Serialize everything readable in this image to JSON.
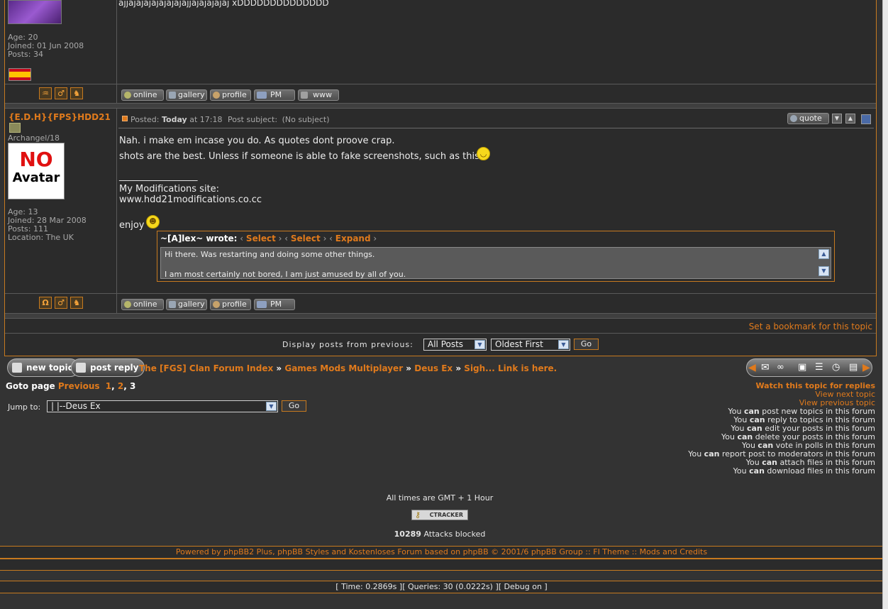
{
  "prev_post": {
    "body_text": "ajjajajajajajajajajjajajajajaj xDDDDDDDDDDDDDD",
    "age": "Age: 20",
    "joined": "Joined: 01 Jun 2008",
    "posts": "Posts: 34",
    "buttons": [
      "online",
      "gallery",
      "profile",
      "PM",
      "www"
    ]
  },
  "post": {
    "author": "{E.D.H}{FPS}HDD21",
    "rank": "Archangel/18",
    "avatar_line1": "NO",
    "avatar_line2": "Avatar",
    "age": "Age: 13",
    "joined": "Joined: 28 Mar 2008",
    "posts": "Posts: 111",
    "location": "Location: The UK",
    "posted_label": "Posted:",
    "posted_day": "Today",
    "posted_time": "at 17:18",
    "subject_label": "Post subject:",
    "subject_value": "(No subject)",
    "quote_button": "quote",
    "line1": "Nah. i make em incase you do. As quotes dont proove crap.",
    "line2": "shots are the best. Unless if someone is able to fake screenshots, such as this.",
    "separator": "_________________",
    "sig_label": "My Modifications site:",
    "sig_link": "www.hdd21modifications.co.cc",
    "enjoy": "enjoy",
    "quote_author": "~[A]lex~ wrote:",
    "quote_select1": "Select",
    "quote_select2": "Select",
    "quote_expand": "Expand",
    "quote_line1": "Hi there. Was restarting and doing some other things.",
    "quote_line2": "I am most certainly not bored, I am just amused by all of you.",
    "buttons": [
      "online",
      "gallery",
      "profile",
      "PM"
    ]
  },
  "bookmark": "Set a bookmark for this topic",
  "display": {
    "label": "Display posts from previous:",
    "posts_select": "All Posts",
    "order_select": "Oldest First",
    "go": "Go"
  },
  "nav": {
    "new_topic": "new topic",
    "post_reply": "post reply",
    "breadcrumb": [
      "The [FGS] Clan Forum Index",
      "Games Mods Multiplayer",
      "Deus Ex",
      "Sigh... Link is here."
    ],
    "sep": "»"
  },
  "pagination": {
    "label": "Goto page",
    "previous": "Previous",
    "p1": "1",
    "p2": "2",
    "p3": "3"
  },
  "jump": {
    "label": "Jump to:",
    "value": "|   |--Deus Ex",
    "go": "Go"
  },
  "right_links": [
    "Watch this topic for replies",
    "View next topic",
    "View previous topic"
  ],
  "permissions": [
    {
      "pre": "You ",
      "can": "can",
      "post": " post new topics in this forum"
    },
    {
      "pre": "You ",
      "can": "can",
      "post": " reply to topics in this forum"
    },
    {
      "pre": "You ",
      "can": "can",
      "post": " edit your posts in this forum"
    },
    {
      "pre": "You ",
      "can": "can",
      "post": " delete your posts in this forum"
    },
    {
      "pre": "You ",
      "can": "can",
      "post": " vote in polls in this forum"
    },
    {
      "pre": "You ",
      "can": "can",
      "post": " report post to moderators in this forum"
    },
    {
      "pre": "You ",
      "can": "can",
      "post": " attach files in this forum"
    },
    {
      "pre": "You ",
      "can": "can",
      "post": " download files in this forum"
    }
  ],
  "footer": {
    "timezone": "All times are GMT + 1 Hour",
    "ctracker": "CTRACKER",
    "attacks_count": "10289",
    "attacks_label": "Attacks blocked",
    "powered": "Powered by phpBB2 Plus, phpBB Styles and Kostenloses Forum based on phpBB © 2001/6 phpBB Group :: FI Theme :: Mods and Credits",
    "debug": "[ Time: 0.2869s ][ Queries: 30 (0.0222s) ][ Debug on ]"
  },
  "colors": {
    "accent": "#e07a1c",
    "border": "#c77a1f",
    "background": "#333333",
    "panel": "#2b2b2b"
  }
}
